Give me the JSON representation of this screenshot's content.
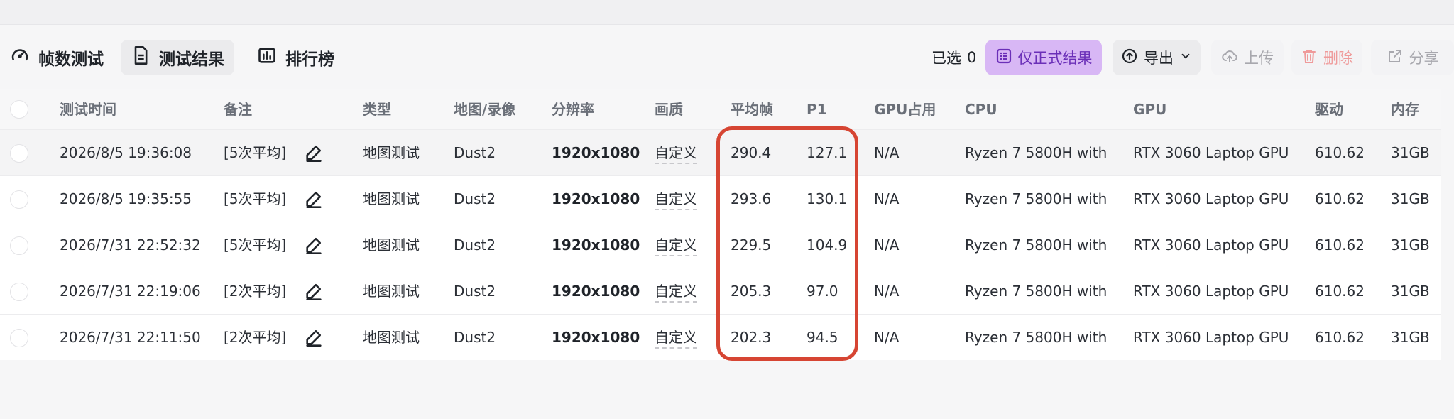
{
  "tabs": [
    {
      "label": "帧数测试",
      "icon": "gauge-icon"
    },
    {
      "label": "测试结果",
      "icon": "document-icon"
    },
    {
      "label": "排行榜",
      "icon": "bar-chart-icon"
    }
  ],
  "selection": {
    "label": "已选",
    "count": "0"
  },
  "actions": {
    "formal_only": "仅正式结果",
    "export": "导出",
    "upload": "上传",
    "delete": "删除",
    "share": "分享"
  },
  "columns": [
    "测试时间",
    "备注",
    "类型",
    "地图/录像",
    "分辨率",
    "画质",
    "平均帧",
    "P1",
    "GPU占用",
    "CPU",
    "GPU",
    "驱动",
    "内存"
  ],
  "rows": [
    [
      "2026/8/5 19:36:08",
      "[5次平均]",
      "地图测试",
      "Dust2",
      "1920x1080",
      "自定义",
      "290.4",
      "127.1",
      "N/A",
      "Ryzen 7 5800H with",
      "RTX 3060 Laptop GPU",
      "610.62",
      "31GB"
    ],
    [
      "2026/8/5 19:35:55",
      "[5次平均]",
      "地图测试",
      "Dust2",
      "1920x1080",
      "自定义",
      "293.6",
      "130.1",
      "N/A",
      "Ryzen 7 5800H with",
      "RTX 3060 Laptop GPU",
      "610.62",
      "31GB"
    ],
    [
      "2026/7/31 22:52:32",
      "[5次平均]",
      "地图测试",
      "Dust2",
      "1920x1080",
      "自定义",
      "229.5",
      "104.9",
      "N/A",
      "Ryzen 7 5800H with",
      "RTX 3060 Laptop GPU",
      "610.62",
      "31GB"
    ],
    [
      "2026/7/31 22:19:06",
      "[2次平均]",
      "地图测试",
      "Dust2",
      "1920x1080",
      "自定义",
      "205.3",
      "97.0",
      "N/A",
      "Ryzen 7 5800H with",
      "RTX 3060 Laptop GPU",
      "610.62",
      "31GB"
    ],
    [
      "2026/7/31 22:11:50",
      "[2次平均]",
      "地图测试",
      "Dust2",
      "1920x1080",
      "自定义",
      "202.3",
      "94.5",
      "N/A",
      "Ryzen 7 5800H with",
      "RTX 3060 Laptop GPU",
      "610.62",
      "31GB"
    ]
  ],
  "colors": {
    "accent_bg": "#d8b7f5",
    "accent_text": "#6b2fb8",
    "highlight": "#d64533",
    "delete": "#ef9a9a"
  }
}
